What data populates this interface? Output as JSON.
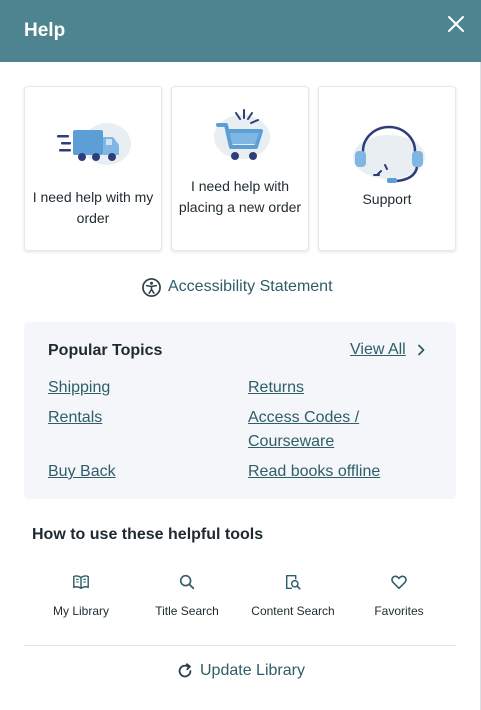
{
  "header": {
    "title": "Help",
    "background": "#4e848f"
  },
  "cards": [
    {
      "label": "I need help with my order",
      "icon": "delivery-truck-icon"
    },
    {
      "label": "I need help with placing a new order",
      "icon": "shopping-cart-icon"
    },
    {
      "label": "Support",
      "icon": "headset-icon"
    }
  ],
  "accessibility": {
    "label": "Accessibility Statement",
    "icon": "accessibility-icon"
  },
  "popular_topics": {
    "title": "Popular Topics",
    "view_all": "View All",
    "links": {
      "shipping": "Shipping",
      "returns": "Returns",
      "rentals": "Rentals",
      "access_codes_line1": "Access Codes /",
      "access_codes_line2": "Courseware",
      "buy_back": "Buy Back",
      "read_offline": "Read books offline"
    }
  },
  "tools": {
    "title": "How to use these helpful tools",
    "items": [
      {
        "label": "My Library",
        "icon": "book-icon"
      },
      {
        "label": "Title Search",
        "icon": "search-icon"
      },
      {
        "label": "Content Search",
        "icon": "document-search-icon"
      },
      {
        "label": "Favorites",
        "icon": "heart-icon"
      }
    ]
  },
  "update_library": {
    "label": "Update Library",
    "icon": "refresh-icon"
  },
  "colors": {
    "link": "#2f5d68",
    "accent_blue": "#5b9fd6",
    "navy": "#2d3e78"
  }
}
